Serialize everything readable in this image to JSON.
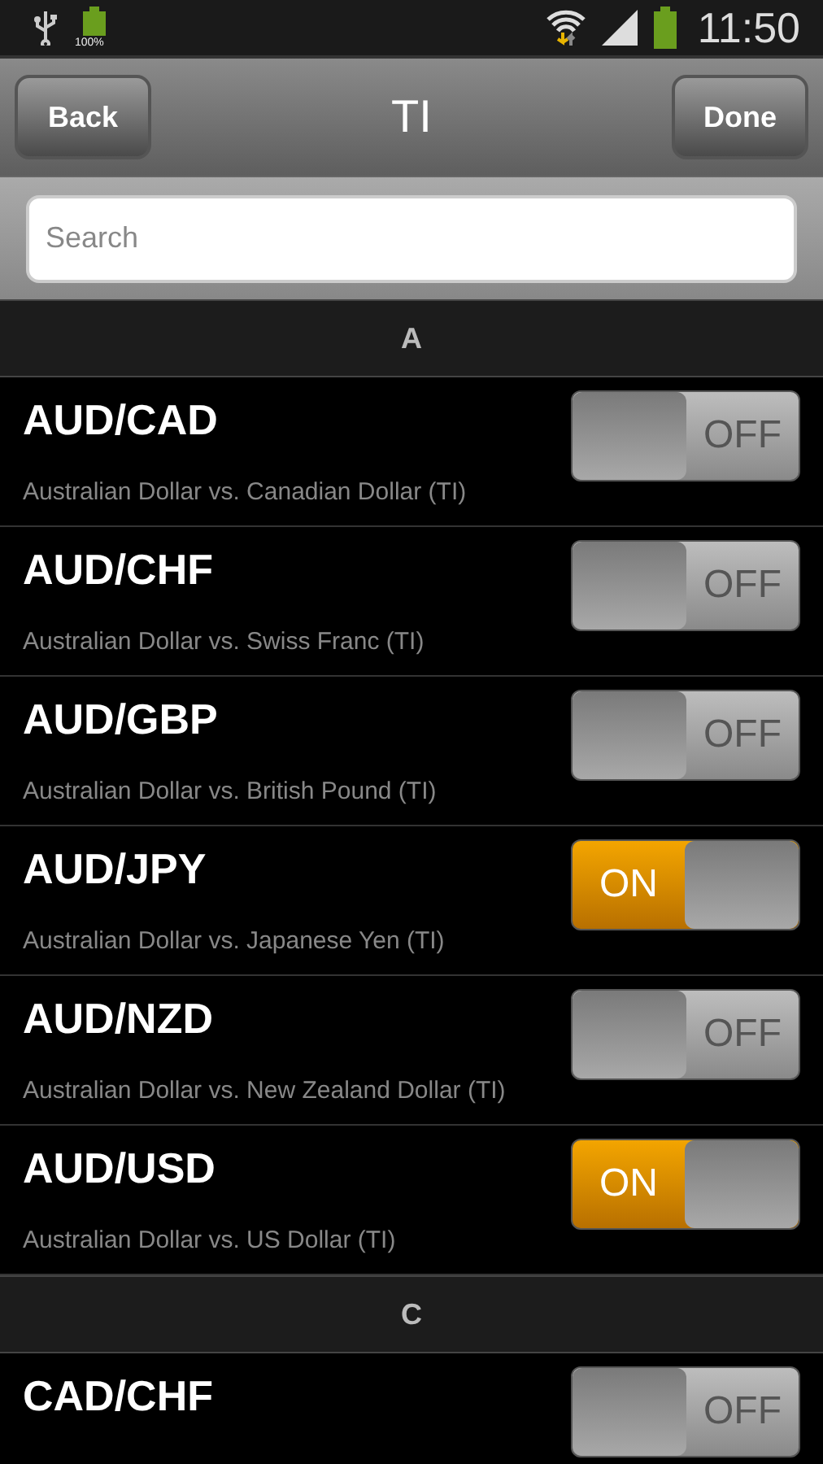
{
  "status_bar": {
    "battery_label": "100%",
    "time": "11:50"
  },
  "header": {
    "back": "Back",
    "title": "TI",
    "done": "Done"
  },
  "search": {
    "placeholder": "Search"
  },
  "sections": [
    {
      "letter": "A",
      "items": [
        {
          "code": "AUD/CAD",
          "name": "Australian Dollar vs. Canadian Dollar (TI)",
          "on": false,
          "toggle_label": "OFF"
        },
        {
          "code": "AUD/CHF",
          "name": "Australian Dollar vs. Swiss Franc (TI)",
          "on": false,
          "toggle_label": "OFF"
        },
        {
          "code": "AUD/GBP",
          "name": "Australian Dollar vs. British Pound (TI)",
          "on": false,
          "toggle_label": "OFF"
        },
        {
          "code": "AUD/JPY",
          "name": "Australian Dollar vs. Japanese Yen (TI)",
          "on": true,
          "toggle_label": "ON"
        },
        {
          "code": "AUD/NZD",
          "name": "Australian Dollar vs. New Zealand Dollar (TI)",
          "on": false,
          "toggle_label": "OFF"
        },
        {
          "code": "AUD/USD",
          "name": "Australian Dollar vs. US Dollar (TI)",
          "on": true,
          "toggle_label": "ON"
        }
      ]
    },
    {
      "letter": "C",
      "items": [
        {
          "code": "CAD/CHF",
          "on": false,
          "toggle_label": "OFF"
        }
      ]
    }
  ]
}
